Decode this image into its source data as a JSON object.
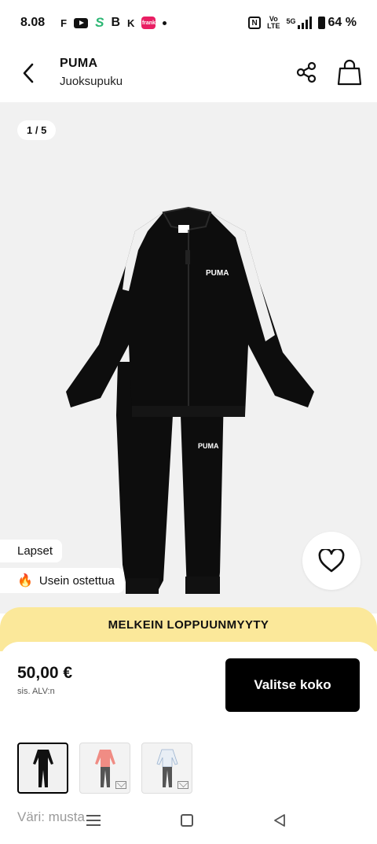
{
  "status_bar": {
    "time": "8.08",
    "app_icons": [
      "F",
      "youtube-icon",
      "S",
      "B",
      "K",
      "frank",
      "dot"
    ],
    "icon_f": "F",
    "icon_s": "S",
    "icon_b": "B",
    "icon_k": "K",
    "frank": "frank",
    "nfc": "N",
    "volte_top": "Vo",
    "volte_bottom": "LTE",
    "network": "5G",
    "battery": "64 %"
  },
  "header": {
    "brand": "PUMA",
    "subtitle": "Juoksupuku"
  },
  "gallery": {
    "counter": "1 / 5",
    "logo_text": "PUMA",
    "badges": {
      "kids": "Lapset",
      "popular": "Usein ostettua",
      "popular_icon": "🔥"
    }
  },
  "banner": {
    "text": "MELKEIN LOPPUUNMYYTY",
    "color": "#fbe89a"
  },
  "purchase": {
    "price": "50,00 €",
    "vat_note": "sis. ALV:n",
    "select_size_label": "Valitse koko"
  },
  "variants": [
    {
      "name": "black",
      "selected": true,
      "top_color": "#111111",
      "pants_color": "#111111",
      "stripe": "#ffffff"
    },
    {
      "name": "pink",
      "selected": false,
      "top_color": "#f08c84",
      "pants_color": "#555555",
      "stripe": "#ffffff"
    },
    {
      "name": "white",
      "selected": false,
      "top_color": "#e8eef5",
      "pants_color": "#555555",
      "stripe": "#9bb3d0"
    }
  ],
  "color_label": "Väri: musta",
  "colors": {
    "accent": "#000000",
    "banner": "#fbe89a",
    "gallery_bg": "#f1f1f1"
  }
}
